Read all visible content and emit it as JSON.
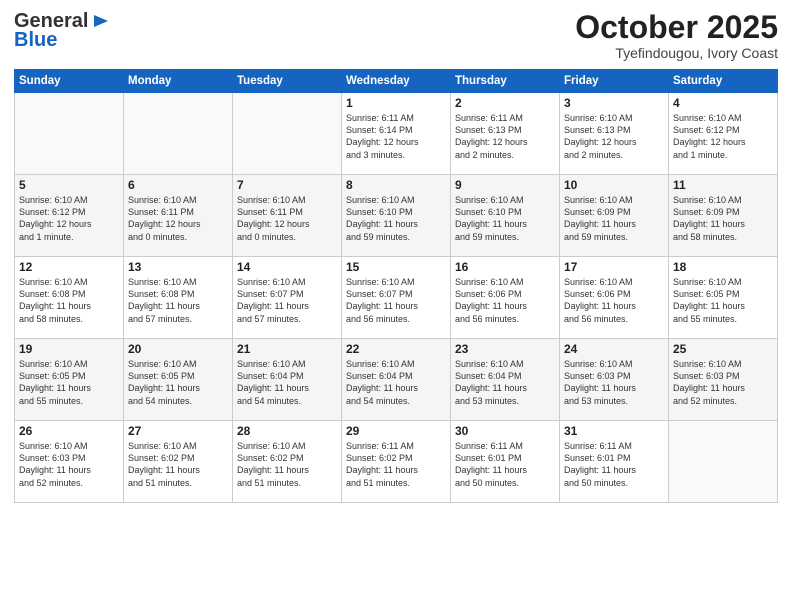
{
  "header": {
    "logo_general": "General",
    "logo_blue": "Blue",
    "month": "October 2025",
    "location": "Tyefindougou, Ivory Coast"
  },
  "weekdays": [
    "Sunday",
    "Monday",
    "Tuesday",
    "Wednesday",
    "Thursday",
    "Friday",
    "Saturday"
  ],
  "weeks": [
    [
      {
        "day": "",
        "info": ""
      },
      {
        "day": "",
        "info": ""
      },
      {
        "day": "",
        "info": ""
      },
      {
        "day": "1",
        "info": "Sunrise: 6:11 AM\nSunset: 6:14 PM\nDaylight: 12 hours\nand 3 minutes."
      },
      {
        "day": "2",
        "info": "Sunrise: 6:11 AM\nSunset: 6:13 PM\nDaylight: 12 hours\nand 2 minutes."
      },
      {
        "day": "3",
        "info": "Sunrise: 6:10 AM\nSunset: 6:13 PM\nDaylight: 12 hours\nand 2 minutes."
      },
      {
        "day": "4",
        "info": "Sunrise: 6:10 AM\nSunset: 6:12 PM\nDaylight: 12 hours\nand 1 minute."
      }
    ],
    [
      {
        "day": "5",
        "info": "Sunrise: 6:10 AM\nSunset: 6:12 PM\nDaylight: 12 hours\nand 1 minute."
      },
      {
        "day": "6",
        "info": "Sunrise: 6:10 AM\nSunset: 6:11 PM\nDaylight: 12 hours\nand 0 minutes."
      },
      {
        "day": "7",
        "info": "Sunrise: 6:10 AM\nSunset: 6:11 PM\nDaylight: 12 hours\nand 0 minutes."
      },
      {
        "day": "8",
        "info": "Sunrise: 6:10 AM\nSunset: 6:10 PM\nDaylight: 11 hours\nand 59 minutes."
      },
      {
        "day": "9",
        "info": "Sunrise: 6:10 AM\nSunset: 6:10 PM\nDaylight: 11 hours\nand 59 minutes."
      },
      {
        "day": "10",
        "info": "Sunrise: 6:10 AM\nSunset: 6:09 PM\nDaylight: 11 hours\nand 59 minutes."
      },
      {
        "day": "11",
        "info": "Sunrise: 6:10 AM\nSunset: 6:09 PM\nDaylight: 11 hours\nand 58 minutes."
      }
    ],
    [
      {
        "day": "12",
        "info": "Sunrise: 6:10 AM\nSunset: 6:08 PM\nDaylight: 11 hours\nand 58 minutes."
      },
      {
        "day": "13",
        "info": "Sunrise: 6:10 AM\nSunset: 6:08 PM\nDaylight: 11 hours\nand 57 minutes."
      },
      {
        "day": "14",
        "info": "Sunrise: 6:10 AM\nSunset: 6:07 PM\nDaylight: 11 hours\nand 57 minutes."
      },
      {
        "day": "15",
        "info": "Sunrise: 6:10 AM\nSunset: 6:07 PM\nDaylight: 11 hours\nand 56 minutes."
      },
      {
        "day": "16",
        "info": "Sunrise: 6:10 AM\nSunset: 6:06 PM\nDaylight: 11 hours\nand 56 minutes."
      },
      {
        "day": "17",
        "info": "Sunrise: 6:10 AM\nSunset: 6:06 PM\nDaylight: 11 hours\nand 56 minutes."
      },
      {
        "day": "18",
        "info": "Sunrise: 6:10 AM\nSunset: 6:05 PM\nDaylight: 11 hours\nand 55 minutes."
      }
    ],
    [
      {
        "day": "19",
        "info": "Sunrise: 6:10 AM\nSunset: 6:05 PM\nDaylight: 11 hours\nand 55 minutes."
      },
      {
        "day": "20",
        "info": "Sunrise: 6:10 AM\nSunset: 6:05 PM\nDaylight: 11 hours\nand 54 minutes."
      },
      {
        "day": "21",
        "info": "Sunrise: 6:10 AM\nSunset: 6:04 PM\nDaylight: 11 hours\nand 54 minutes."
      },
      {
        "day": "22",
        "info": "Sunrise: 6:10 AM\nSunset: 6:04 PM\nDaylight: 11 hours\nand 54 minutes."
      },
      {
        "day": "23",
        "info": "Sunrise: 6:10 AM\nSunset: 6:04 PM\nDaylight: 11 hours\nand 53 minutes."
      },
      {
        "day": "24",
        "info": "Sunrise: 6:10 AM\nSunset: 6:03 PM\nDaylight: 11 hours\nand 53 minutes."
      },
      {
        "day": "25",
        "info": "Sunrise: 6:10 AM\nSunset: 6:03 PM\nDaylight: 11 hours\nand 52 minutes."
      }
    ],
    [
      {
        "day": "26",
        "info": "Sunrise: 6:10 AM\nSunset: 6:03 PM\nDaylight: 11 hours\nand 52 minutes."
      },
      {
        "day": "27",
        "info": "Sunrise: 6:10 AM\nSunset: 6:02 PM\nDaylight: 11 hours\nand 51 minutes."
      },
      {
        "day": "28",
        "info": "Sunrise: 6:10 AM\nSunset: 6:02 PM\nDaylight: 11 hours\nand 51 minutes."
      },
      {
        "day": "29",
        "info": "Sunrise: 6:11 AM\nSunset: 6:02 PM\nDaylight: 11 hours\nand 51 minutes."
      },
      {
        "day": "30",
        "info": "Sunrise: 6:11 AM\nSunset: 6:01 PM\nDaylight: 11 hours\nand 50 minutes."
      },
      {
        "day": "31",
        "info": "Sunrise: 6:11 AM\nSunset: 6:01 PM\nDaylight: 11 hours\nand 50 minutes."
      },
      {
        "day": "",
        "info": ""
      }
    ]
  ]
}
